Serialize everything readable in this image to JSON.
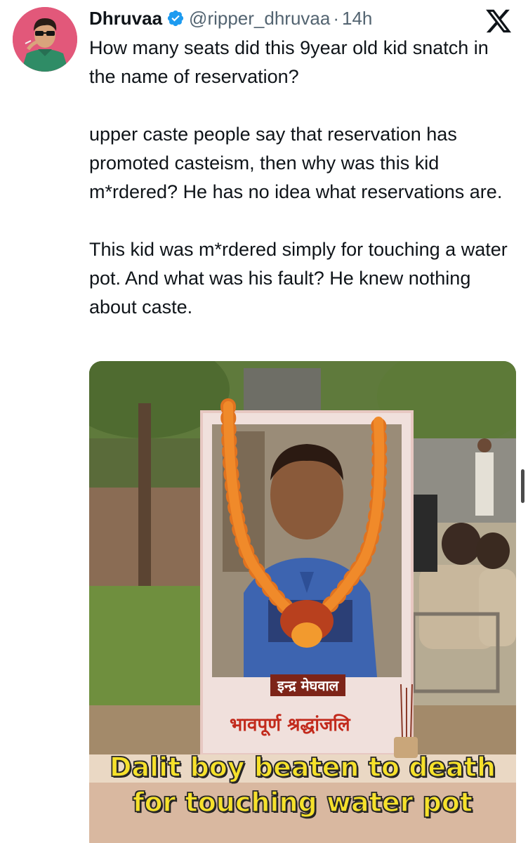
{
  "tweet": {
    "author": {
      "display_name": "Dhruvaa",
      "handle": "@ripper_dhruvaa",
      "verified": true
    },
    "separator": "·",
    "time": "14h",
    "paragraphs": [
      "How many seats did this 9year old kid snatch in the name of reservation?",
      "upper caste people say that reservation has promoted casteism, then why was this kid m*rdered? He has no idea what reservations are.",
      "This kid was m*rdered simply for touching a water pot. And what was his fault? He knew nothing about caste."
    ],
    "media": {
      "name_plate": "इन्द्र मेघवाल",
      "tribute_text": "भावपूर्ण श्रद्धांजलि",
      "caption_line1": "Dalit boy beaten to death",
      "caption_line2": "for touching water pot"
    }
  },
  "icons": {
    "verified": "verified-badge-icon",
    "platform": "x-logo-icon"
  },
  "colors": {
    "verified": "#1d9bf0",
    "text": "#0f1419",
    "secondary": "#536471",
    "caption": "#f6e12b"
  }
}
